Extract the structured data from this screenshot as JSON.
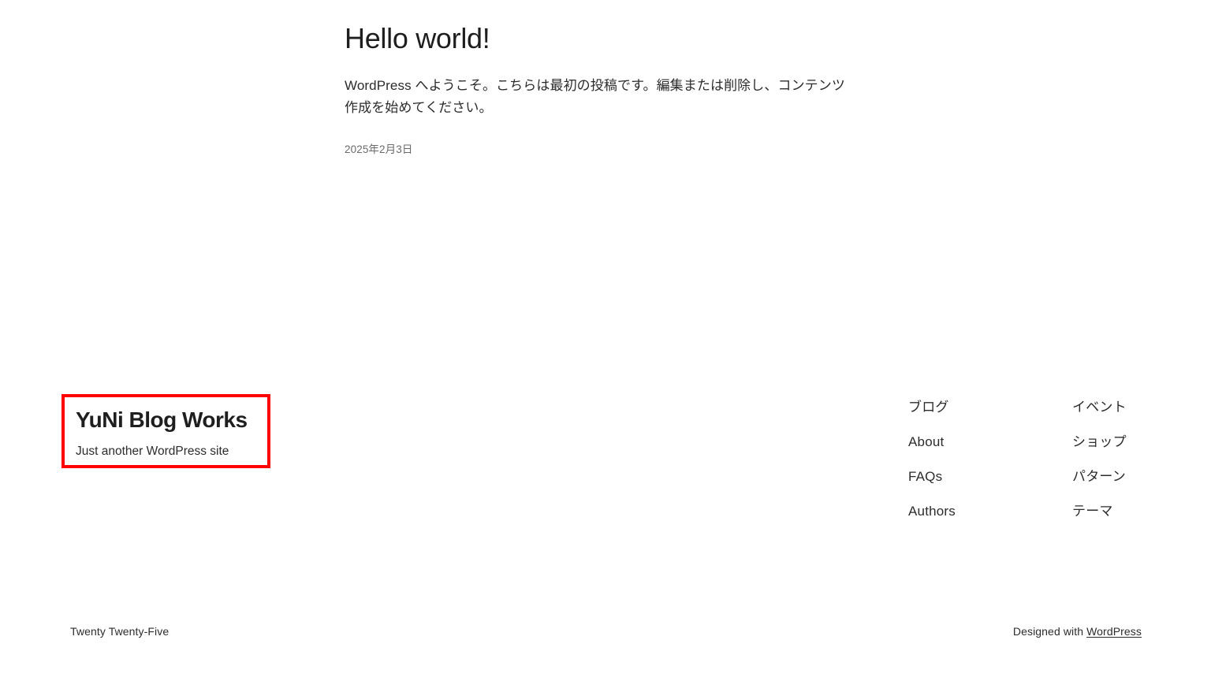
{
  "site": {
    "title": "YuNi Blog Works",
    "tagline": "Just another WordPress site"
  },
  "post": {
    "title": "Hello world!",
    "excerpt": "WordPress へようこそ。こちらは最初の投稿です。編集または削除し、コンテンツ作成を始めてください。",
    "date": "2025年2月3日"
  },
  "footer": {
    "nav_columns": [
      {
        "items": [
          {
            "label": "ブログ"
          },
          {
            "label": "About"
          },
          {
            "label": "FAQs"
          },
          {
            "label": "Authors"
          }
        ]
      },
      {
        "items": [
          {
            "label": "イベント"
          },
          {
            "label": "ショップ"
          },
          {
            "label": "パターン"
          },
          {
            "label": "テーマ"
          }
        ]
      }
    ],
    "theme_credit": "Twenty Twenty-Five",
    "designed_with_prefix": "Designed with ",
    "designed_with_link": "WordPress"
  },
  "annotation": {
    "highlight_color": "#ff0000"
  }
}
